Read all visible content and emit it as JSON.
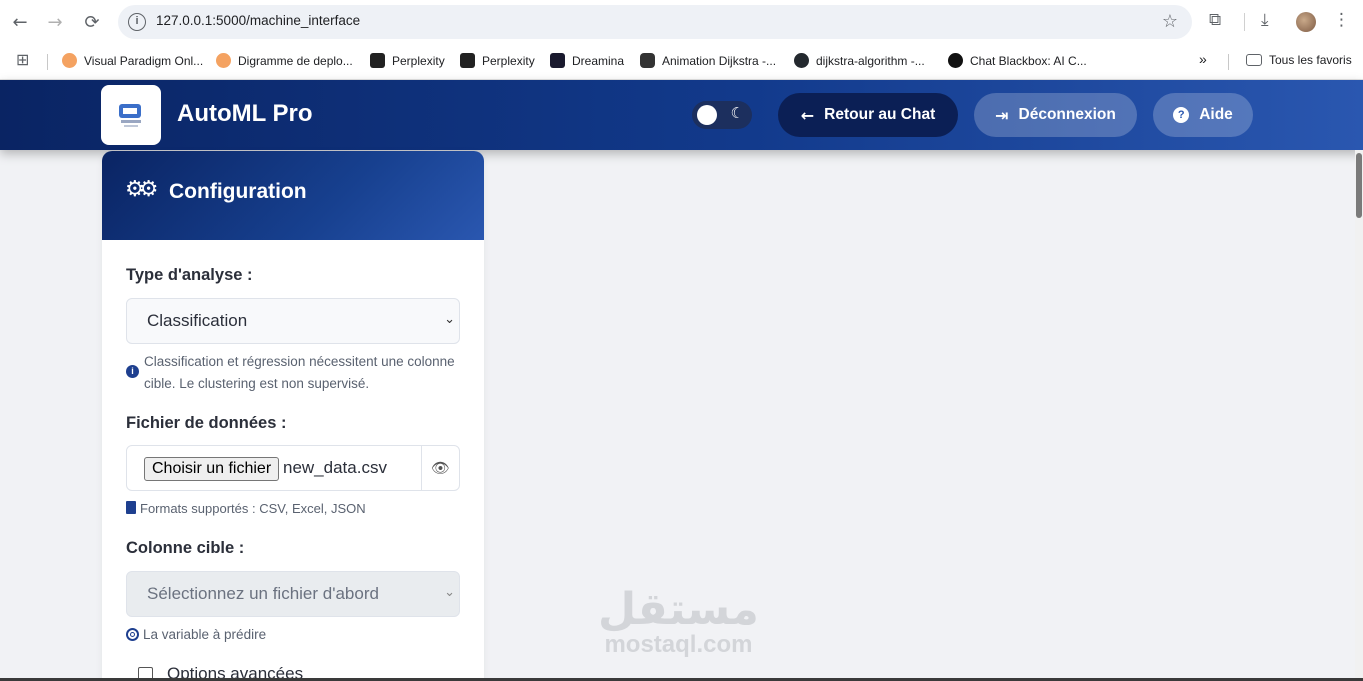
{
  "browser": {
    "url": "127.0.0.1:5000/machine_interface",
    "bookmarks": [
      {
        "label": "Visual Paradigm Onl...",
        "color": "#f4a261"
      },
      {
        "label": "Digramme de deplo...",
        "color": "#f4a261"
      },
      {
        "label": "Perplexity",
        "color": "#222222"
      },
      {
        "label": "Perplexity",
        "color": "#222222"
      },
      {
        "label": "Dreamina",
        "color": "#1a1a2e"
      },
      {
        "label": "Animation Dijkstra -...",
        "color": "#333333"
      },
      {
        "label": "dijkstra-algorithm -...",
        "color": "#24292f"
      },
      {
        "label": "Chat Blackbox: AI C...",
        "color": "#111111"
      }
    ],
    "all_bookmarks": "Tous les favoris",
    "overflow_icon": "»"
  },
  "header": {
    "app_title": "AutoML Pro",
    "theme_toggle_icon": "moon-icon",
    "back_to_chat": "Retour au Chat",
    "logout": "Déconnexion",
    "help": "Aide"
  },
  "config": {
    "title": "Configuration",
    "analysis_type_label": "Type d'analyse :",
    "analysis_type_value": "Classification",
    "analysis_hint": "Classification et régression nécessitent une colonne cible. Le clustering est non supervisé.",
    "data_file_label": "Fichier de données :",
    "choose_file_button": "Choisir un fichier",
    "file_name": "new_data.csv",
    "formats_hint": "Formats supportés : CSV, Excel, JSON",
    "target_label": "Colonne cible :",
    "target_placeholder": "Sélectionnez un fichier d'abord",
    "target_hint": "La variable à prédire",
    "advanced_options": "Options avancées"
  },
  "watermark": {
    "arabic": "مستقل",
    "latin": "mostaql.com"
  },
  "colors": {
    "header_dark": "#0a2463",
    "header_light": "#2a57b0",
    "accent": "#1e3f8f"
  }
}
